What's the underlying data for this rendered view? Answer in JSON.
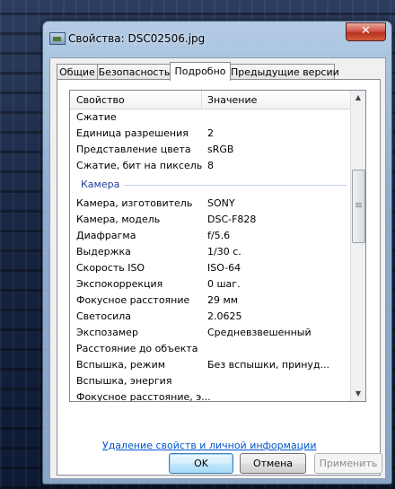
{
  "window": {
    "title": "Свойства: DSC02506.jpg",
    "close_glyph": "✕"
  },
  "tabs": [
    {
      "label": "Общие",
      "active": false
    },
    {
      "label": "Безопасность",
      "active": false
    },
    {
      "label": "Подробно",
      "active": true
    },
    {
      "label": "Предыдущие версии",
      "active": false
    }
  ],
  "table": {
    "headers": {
      "property": "Свойство",
      "value": "Значение"
    },
    "image_rows": [
      {
        "property": "Сжатие",
        "value": ""
      },
      {
        "property": "Единица разрешения",
        "value": "2"
      },
      {
        "property": "Представление цвета",
        "value": "sRGB"
      },
      {
        "property": "Сжатие, бит на пиксель",
        "value": "8"
      }
    ],
    "camera_group": "Камера",
    "camera_rows": [
      {
        "property": "Камера, изготовитель",
        "value": "SONY"
      },
      {
        "property": "Камера, модель",
        "value": "DSC-F828"
      },
      {
        "property": "Диафрагма",
        "value": "f/5.6"
      },
      {
        "property": "Выдержка",
        "value": "1/30 с."
      },
      {
        "property": "Скорость ISO",
        "value": "ISO-64"
      },
      {
        "property": "Экспокоррекция",
        "value": "0 шаг."
      },
      {
        "property": "Фокусное расстояние",
        "value": "29 мм"
      },
      {
        "property": "Светосила",
        "value": "2.0625"
      },
      {
        "property": "Экспозамер",
        "value": "Средневзвешенный"
      },
      {
        "property": "Расстояние до объекта",
        "value": ""
      },
      {
        "property": "Вспышка, режим",
        "value": "Без вспышки, принуд..."
      },
      {
        "property": "Вспышка, энергия",
        "value": ""
      },
      {
        "property": "Фокусное расстояние, э...",
        "value": ""
      }
    ]
  },
  "remove_link": "Удаление свойств и личной информации",
  "buttons": {
    "ok": "OK",
    "cancel": "Отмена",
    "apply": "Применить"
  },
  "colors": {
    "group_label": "#1e3c96",
    "link": "#0055cc",
    "close_button": "#c8402c"
  }
}
